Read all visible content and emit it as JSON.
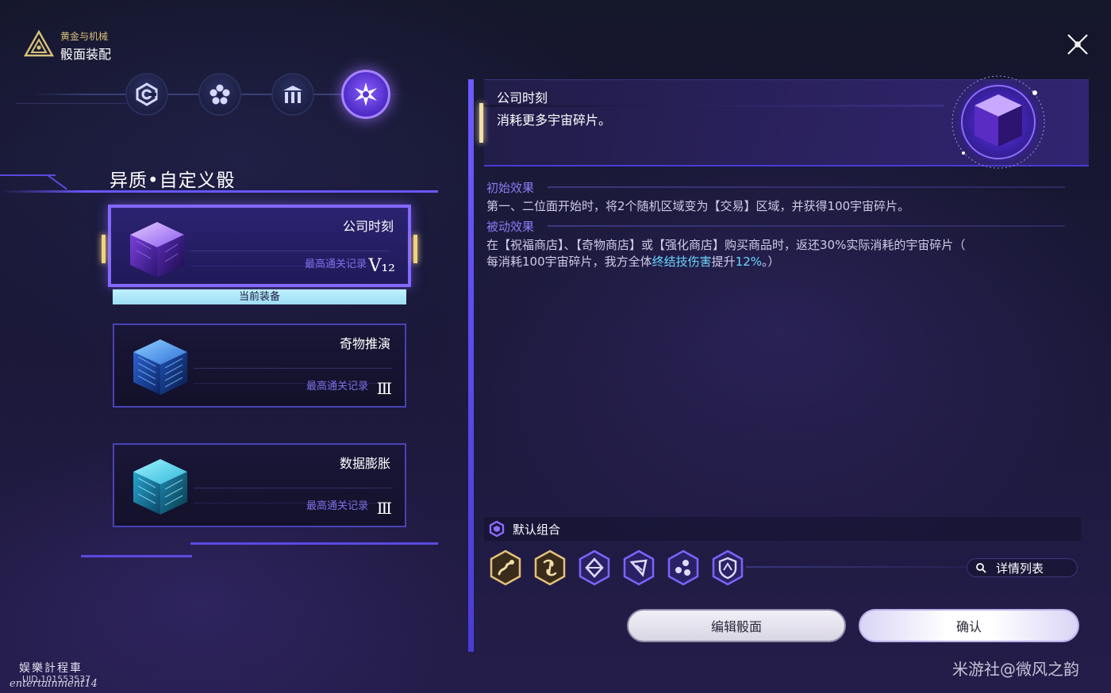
{
  "header": {
    "subtitle": "黄金与机械",
    "title": "骰面装配"
  },
  "icons": {
    "logo": "triangle-emblem-icon",
    "close": "close-icon",
    "categories": [
      "hex-c-icon",
      "flower-icon",
      "pillars-icon",
      "star-burst-icon"
    ]
  },
  "left": {
    "section_title": "异质•自定义骰",
    "cards": [
      {
        "name": "公司时刻",
        "record_label": "最高通关记录",
        "record_value": "V₁₂",
        "selected": true
      },
      {
        "name": "奇物推演",
        "record_label": "最高通关记录",
        "record_value": "Ⅲ",
        "selected": false
      },
      {
        "name": "数据膨胀",
        "record_label": "最高通关记录",
        "record_value": "Ⅲ",
        "selected": false
      }
    ],
    "equipped_label": "当前装备"
  },
  "detail": {
    "name": "公司时刻",
    "tagline": "消耗更多宇宙碎片。",
    "initial_effect_label": "初始效果",
    "initial_effect_text": "第一、二位面开始时，将2个随机区域变为【交易】区域，并获得100宇宙碎片。",
    "passive_effect_label": "被动效果",
    "passive_effect_text_1": "在【祝福商店】、【奇物商店】或【强化商店】购买商品时，返还30%实际消耗的宇宙碎片（",
    "passive_effect_text_2a": "每消耗100宇宙碎片，我方全体",
    "passive_effect_highlight": "终结技伤害",
    "passive_effect_text_2b": "提升",
    "passive_effect_value": "12%",
    "passive_effect_text_2c": "。）"
  },
  "combo": {
    "title": "默认组合",
    "chips": [
      {
        "icon": "arrow-path-icon",
        "tier": "gold"
      },
      {
        "icon": "vortex-icon",
        "tier": "gold"
      },
      {
        "icon": "diamond-icon",
        "tier": "purple"
      },
      {
        "icon": "flag-icon",
        "tier": "purple"
      },
      {
        "icon": "cluster-icon",
        "tier": "purple"
      },
      {
        "icon": "shield-icon",
        "tier": "purple"
      }
    ],
    "detail_list_label": "详情列表"
  },
  "buttons": {
    "edit": "编辑骰面",
    "confirm": "确认"
  },
  "watermarks": {
    "left_line1": "娱樂計程車",
    "left_line2": "UID 101553537",
    "left_line3": "entertainment14",
    "right": "米游社@微风之韵"
  },
  "colors": {
    "accent": "#6a58ff",
    "highlight": "#6bd6ff",
    "gold": "#f1d27c",
    "equipped_bg": "#bff1ff"
  }
}
